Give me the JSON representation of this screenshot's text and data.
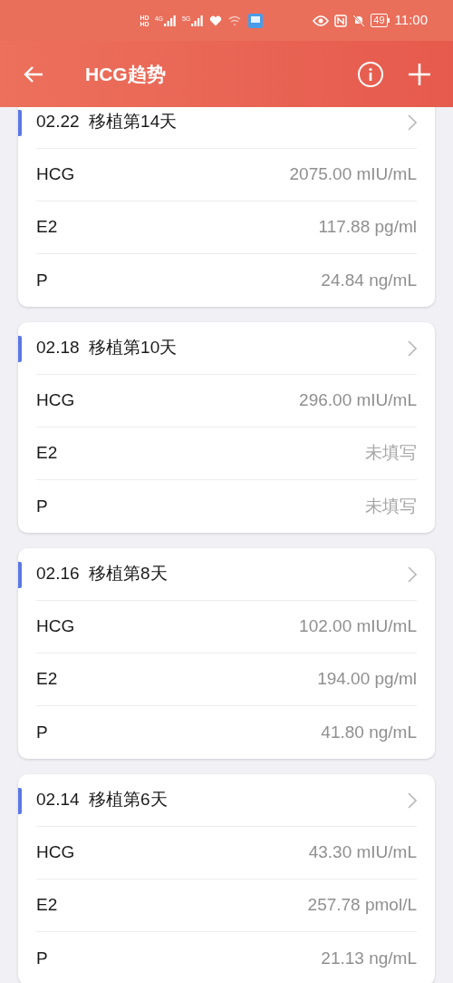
{
  "status_bar": {
    "hd_labels": [
      "HD",
      "HD"
    ],
    "networks": [
      "4G",
      "5G"
    ],
    "battery": "49",
    "time": "11:00"
  },
  "header": {
    "title": "HCG趋势"
  },
  "records": [
    {
      "title": "02.22  移植第14天",
      "rows": [
        {
          "label": "HCG",
          "value": "2075.00 mIU/mL",
          "filled": true
        },
        {
          "label": "E2",
          "value": "117.88 pg/ml",
          "filled": true
        },
        {
          "label": "P",
          "value": "24.84 ng/mL",
          "filled": true
        }
      ]
    },
    {
      "title": "02.18  移植第10天",
      "rows": [
        {
          "label": "HCG",
          "value": "296.00 mIU/mL",
          "filled": true
        },
        {
          "label": "E2",
          "value": "未填写",
          "filled": false
        },
        {
          "label": "P",
          "value": "未填写",
          "filled": false
        }
      ]
    },
    {
      "title": "02.16  移植第8天",
      "rows": [
        {
          "label": "HCG",
          "value": "102.00 mIU/mL",
          "filled": true
        },
        {
          "label": "E2",
          "value": "194.00 pg/ml",
          "filled": true
        },
        {
          "label": "P",
          "value": "41.80 ng/mL",
          "filled": true
        }
      ]
    },
    {
      "title": "02.14  移植第6天",
      "rows": [
        {
          "label": "HCG",
          "value": "43.30 mIU/mL",
          "filled": true
        },
        {
          "label": "E2",
          "value": "257.78 pmol/L",
          "filled": true
        },
        {
          "label": "P",
          "value": "21.13 ng/mL",
          "filled": true
        }
      ]
    }
  ]
}
